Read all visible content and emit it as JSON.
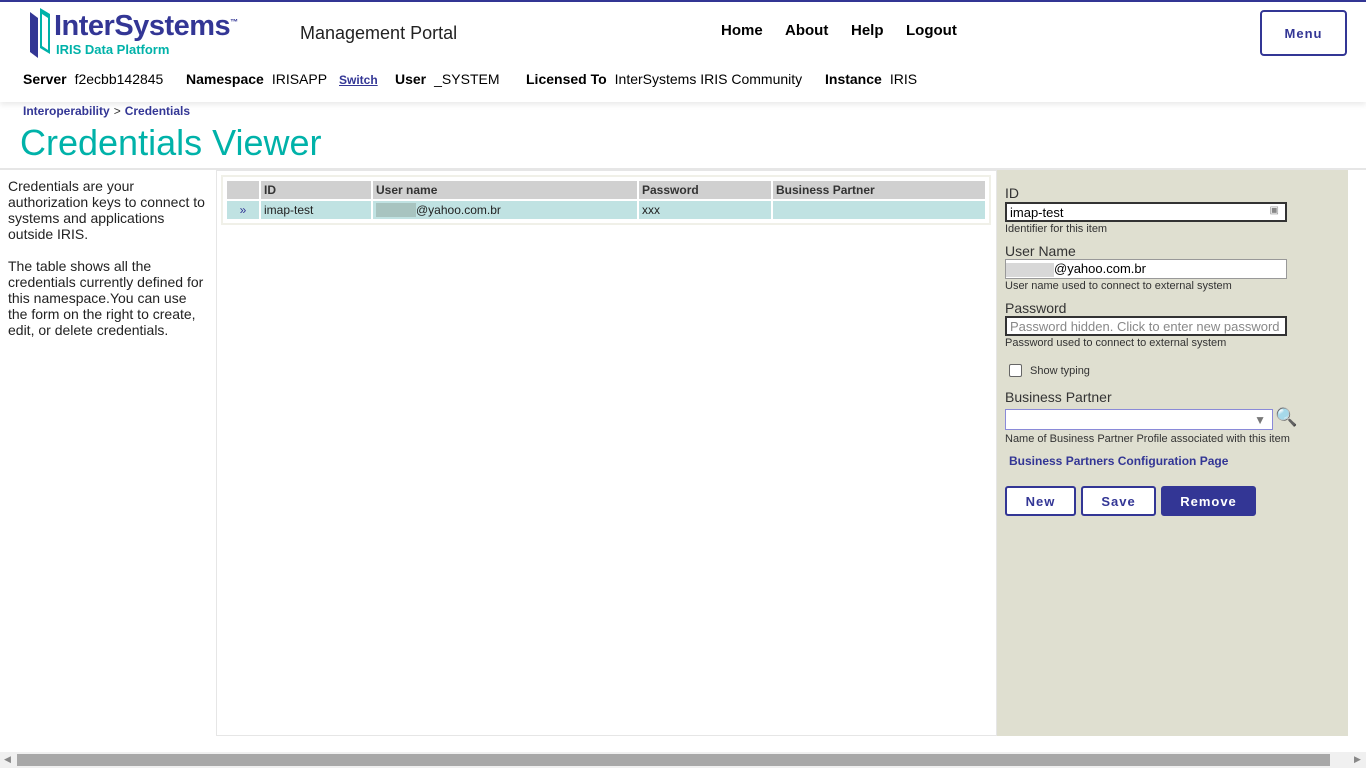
{
  "header": {
    "logo_main": "InterSystems",
    "logo_tm": "™",
    "logo_sub": "IRIS Data Platform",
    "portal": "Management Portal",
    "nav": [
      "Home",
      "About",
      "Help",
      "Logout"
    ],
    "menu": "Menu",
    "server_label": "Server",
    "server": "f2ecbb142845",
    "namespace_label": "Namespace",
    "namespace": "IRISAPP",
    "switch": "Switch",
    "user_label": "User",
    "user": "_SYSTEM",
    "licensed_label": "Licensed To",
    "licensed": "InterSystems IRIS Community",
    "instance_label": "Instance",
    "instance": "IRIS"
  },
  "breadcrumb": {
    "parent": "Interoperability",
    "sep": ">",
    "current": "Credentials"
  },
  "title": "Credentials Viewer",
  "description": [
    "Credentials are your authorization keys to connect to systems and applications outside IRIS.",
    "The table shows all the credentials currently defined for this namespace.You can use the form on the right to create, edit, or delete credentials."
  ],
  "table": {
    "headers": [
      "",
      "ID",
      "User name",
      "Password",
      "Business Partner"
    ],
    "rows": [
      {
        "marker": "»",
        "id": "imap-test",
        "user": "@yahoo.com.br",
        "password": "xxx",
        "partner": ""
      }
    ]
  },
  "form": {
    "id_label": "ID",
    "id_value": "imap-test",
    "id_hint": "Identifier for this item",
    "user_label": "User Name",
    "user_value": "@yahoo.com.br",
    "user_hint": "User name used to connect to external system",
    "pw_label": "Password",
    "pw_placeholder": "Password hidden. Click to enter new password",
    "pw_hint": "Password used to connect to external system",
    "show_typing": "Show typing",
    "bp_label": "Business Partner",
    "bp_value": "",
    "bp_hint": "Name of Business Partner Profile associated with this item",
    "bp_link": "Business Partners Configuration Page",
    "new": "New",
    "save": "Save",
    "remove": "Remove"
  }
}
